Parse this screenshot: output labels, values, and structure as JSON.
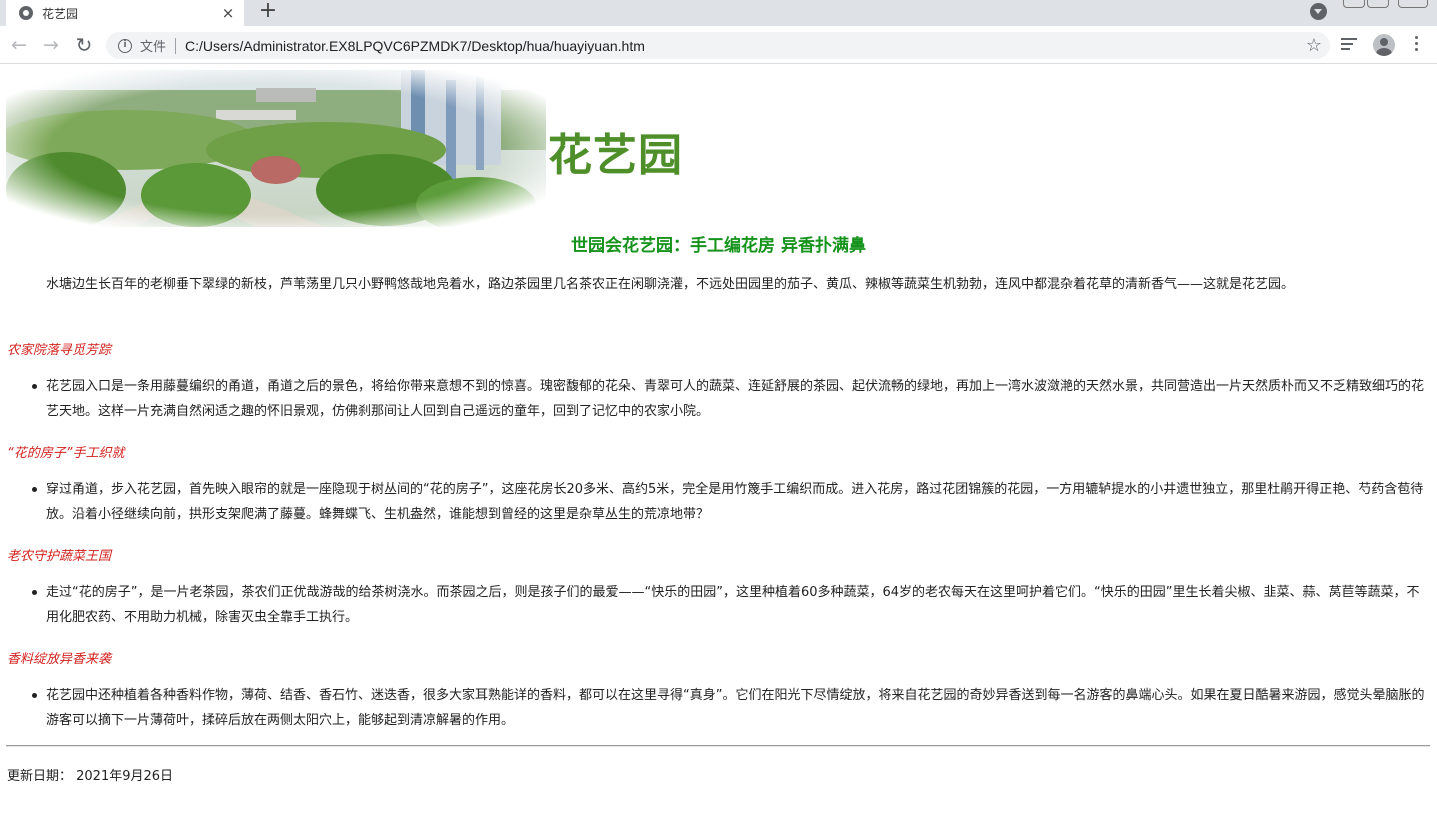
{
  "browser": {
    "tab_title": "花艺园",
    "new_tab": "+",
    "close": "×",
    "scheme_label": "文件",
    "url": "C:/Users/Administrator.EX8LPQVC6PZMDK7/Desktop/hua/huayiyuan.htm",
    "info": "i"
  },
  "page": {
    "site_title": "花艺园",
    "headline": "世园会花艺园：手工编花房 异香扑满鼻",
    "intro": "水塘边生长百年的老柳垂下翠绿的新枝，芦苇荡里几只小野鸭悠哉地凫着水，路边茶园里几名茶农正在闲聊浇灌，不远处田园里的茄子、黄瓜、辣椒等蔬菜生机勃勃，连风中都混杂着花草的清新香气——这就是花艺园。",
    "sections": [
      {
        "heading": "农家院落寻觅芳踪",
        "body": "花艺园入口是一条用藤蔓编织的甬道，甬道之后的景色，将给你带来意想不到的惊喜。瑰密馥郁的花朵、青翠可人的蔬菜、连延舒展的茶园、起伏流畅的绿地，再加上一湾水波潋滟的天然水景，共同营造出一片天然质朴而又不乏精致细巧的花艺天地。这样一片充满自然闲适之趣的怀旧景观，仿佛刹那间让人回到自己遥远的童年，回到了记忆中的农家小院。"
      },
      {
        "heading": "“花的房子”手工织就",
        "body": "穿过甬道，步入花艺园，首先映入眼帘的就是一座隐现于树丛间的“花的房子”，这座花房长20多米、高约5米，完全是用竹篾手工编织而成。进入花房，路过花团锦簇的花园，一方用辘轳提水的小井遗世独立，那里杜鹃开得正艳、芍药含苞待放。沿着小径继续向前，拱形支架爬满了藤蔓。蜂舞蝶飞、生机盎然，谁能想到曾经的这里是杂草丛生的荒凉地带？"
      },
      {
        "heading": "老农守护蔬菜王国",
        "body": "走过“花的房子”，是一片老茶园，茶农们正优哉游哉的给茶树浇水。而茶园之后，则是孩子们的最爱——“快乐的田园”，这里种植着60多种蔬菜，64岁的老农每天在这里呵护着它们。“快乐的田园”里生长着尖椒、韭菜、蒜、莴苣等蔬菜，不用化肥农药、不用助力机械，除害灭虫全靠手工执行。"
      },
      {
        "heading": "香料绽放异香来袭",
        "body": "花艺园中还种植着各种香料作物，薄荷、结香、香石竹、迷迭香，很多大家耳熟能详的香料，都可以在这里寻得“真身”。它们在阳光下尽情绽放，将来自花艺园的奇妙异香送到每一名游客的鼻端心头。如果在夏日酷暑来游园，感觉头晕脑胀的游客可以摘下一片薄荷叶，揉碎后放在两侧太阳穴上，能够起到清凉解暑的作用。"
      }
    ],
    "updated": "更新日期： 2021年9月26日"
  },
  "colors": {
    "title_green": "#4e8f2a",
    "headline_green": "#16931c",
    "section_red": "#d2221e"
  }
}
